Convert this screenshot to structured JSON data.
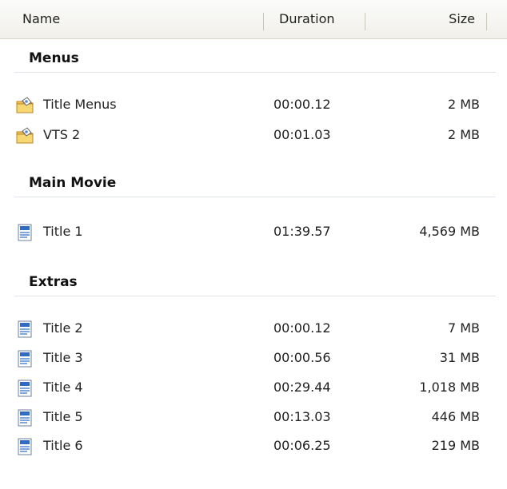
{
  "columns": {
    "name": "Name",
    "duration": "Duration",
    "size": "Size"
  },
  "groups": [
    {
      "title": "Menus",
      "items": [
        {
          "icon": "folder-icon",
          "name": "Title Menus",
          "duration": "00:00.12",
          "size": "2 MB"
        },
        {
          "icon": "folder-icon",
          "name": "VTS 2",
          "duration": "00:01.03",
          "size": "2 MB"
        }
      ]
    },
    {
      "title": "Main Movie",
      "items": [
        {
          "icon": "video-file-icon",
          "name": "Title 1",
          "duration": "01:39.57",
          "size": "4,569 MB"
        }
      ]
    },
    {
      "title": "Extras",
      "items": [
        {
          "icon": "video-file-icon",
          "name": "Title 2",
          "duration": "00:00.12",
          "size": "7 MB"
        },
        {
          "icon": "video-file-icon",
          "name": "Title 3",
          "duration": "00:00.56",
          "size": "31 MB"
        },
        {
          "icon": "video-file-icon",
          "name": "Title 4",
          "duration": "00:29.44",
          "size": "1,018 MB"
        },
        {
          "icon": "video-file-icon",
          "name": "Title 5",
          "duration": "00:13.03",
          "size": "446 MB"
        },
        {
          "icon": "video-file-icon",
          "name": "Title 6",
          "duration": "00:06.25",
          "size": "219 MB"
        }
      ]
    }
  ]
}
